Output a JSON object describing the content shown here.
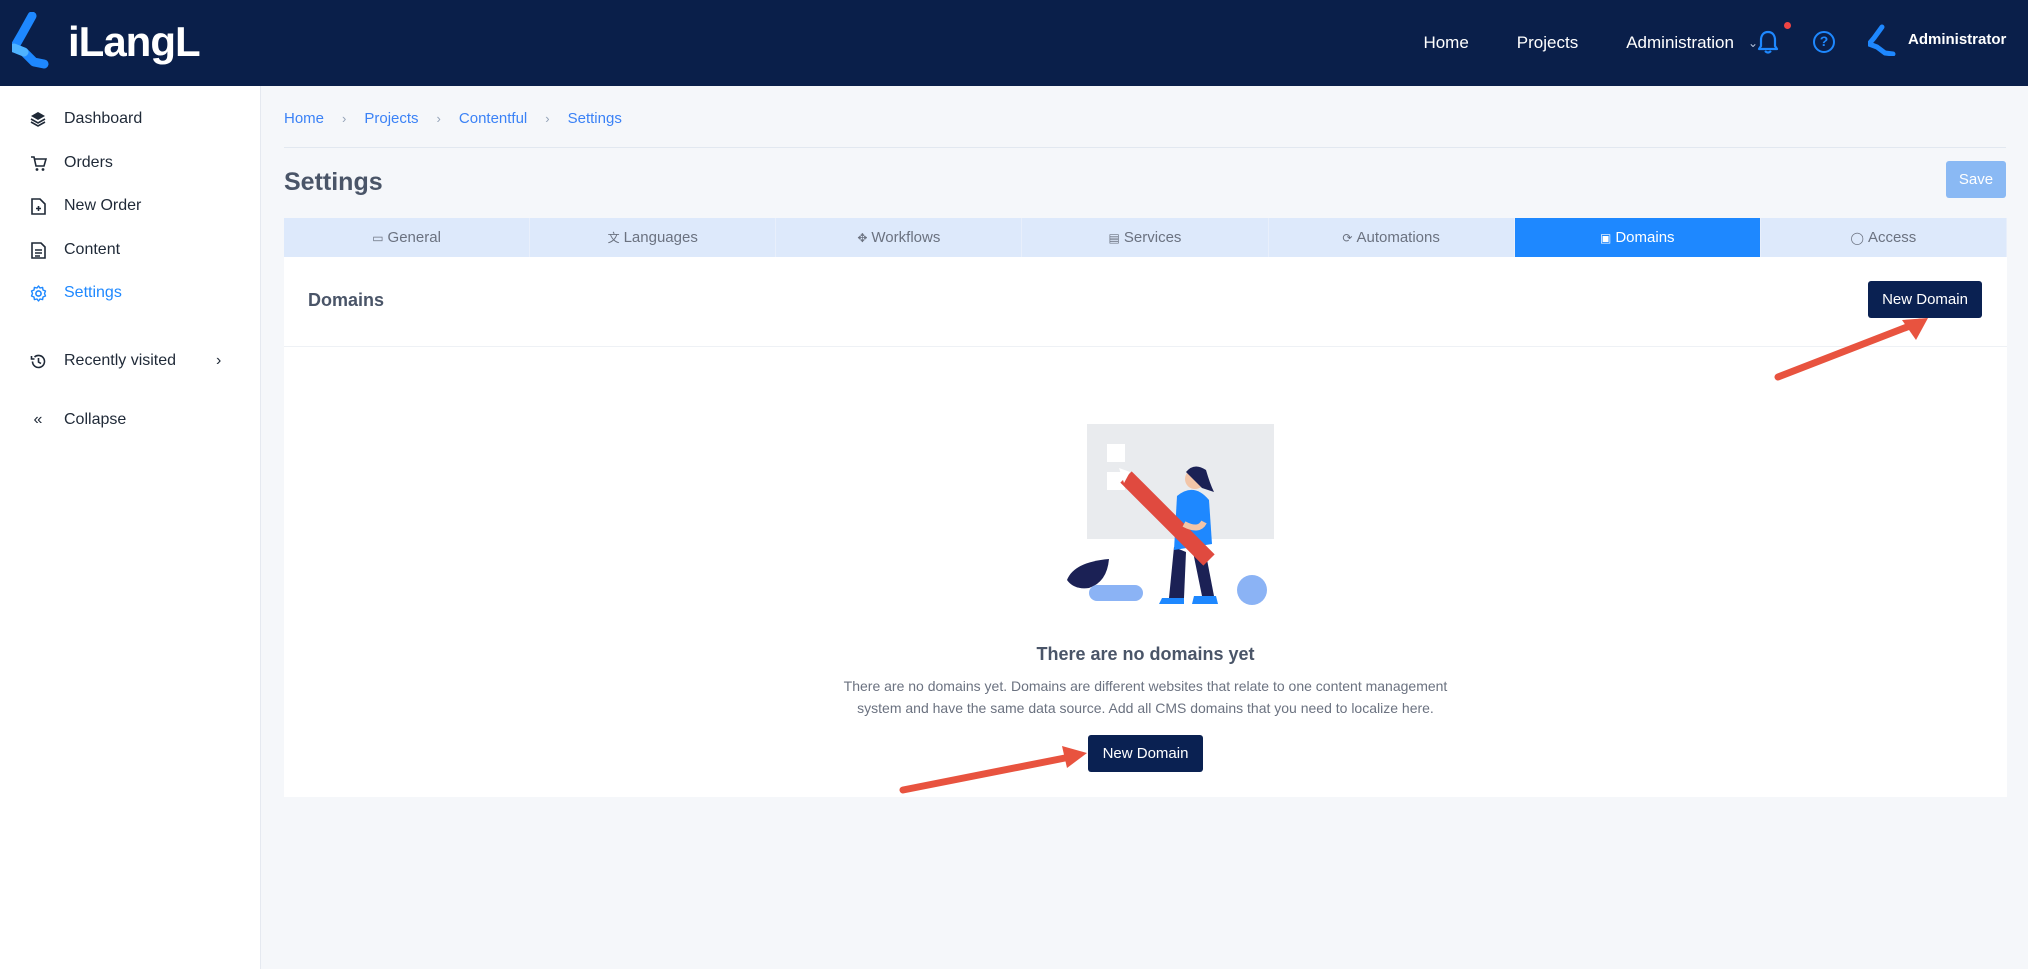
{
  "app": {
    "logo_text": "iLangL"
  },
  "topnav": {
    "links": [
      {
        "label": "Home"
      },
      {
        "label": "Projects"
      },
      {
        "label": "Administration"
      }
    ],
    "user_name": "Administrator",
    "help_glyph": "?",
    "icons": [
      "bell-icon",
      "help-icon",
      "avatar-icon"
    ]
  },
  "sidebar": {
    "items": [
      {
        "label": "Dashboard",
        "icon": "layers-icon",
        "active": false
      },
      {
        "label": "Orders",
        "icon": "cart-icon",
        "active": false
      },
      {
        "label": "New Order",
        "icon": "file-plus-icon",
        "active": false
      },
      {
        "label": "Content",
        "icon": "document-icon",
        "active": false
      },
      {
        "label": "Settings",
        "icon": "gear-icon",
        "active": true
      },
      {
        "label": "Recently visited",
        "icon": "history-icon",
        "active": false
      },
      {
        "label": "Collapse",
        "icon": "double-chevron-left-icon",
        "active": false
      }
    ]
  },
  "breadcrumb": [
    "Home",
    "Projects",
    "Contentful",
    "Settings"
  ],
  "page": {
    "title": "Settings",
    "save_label": "Save"
  },
  "tabs": [
    {
      "label": "General",
      "icon": "window-icon",
      "active": false
    },
    {
      "label": "Languages",
      "icon": "translate-icon",
      "active": false
    },
    {
      "label": "Workflows",
      "icon": "workflow-icon",
      "active": false
    },
    {
      "label": "Services",
      "icon": "server-icon",
      "active": false
    },
    {
      "label": "Automations",
      "icon": "refresh-icon",
      "active": false
    },
    {
      "label": "Domains",
      "icon": "building-icon",
      "active": true
    },
    {
      "label": "Access",
      "icon": "shield-check-icon",
      "active": false
    }
  ],
  "panel": {
    "title": "Domains",
    "new_domain_label": "New Domain",
    "empty_title": "There are no domains yet",
    "empty_description": "There are no domains yet. Domains are different websites that relate to one content management system and have the same data source. Add all CMS domains that you need to localize here.",
    "empty_button_label": "New Domain"
  },
  "colors": {
    "topbar": "#0a1f4a",
    "accent": "#1e88ff",
    "dark_button": "#0a2152",
    "annotation_arrow": "#e8533f"
  }
}
